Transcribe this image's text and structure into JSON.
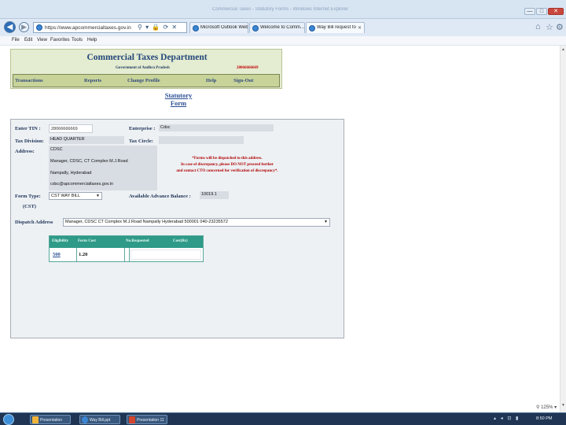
{
  "window": {
    "title": "Commercial Taxes - Statutory Forms - Windows Internet Explorer",
    "minimize": "—",
    "maximize": "□",
    "close": "✕"
  },
  "browser": {
    "address": "https://www.apcommercialtaxes.gov.in/ctd/dealer",
    "address_icons": "⚲ ▾ 🔒 ⟳ ✕",
    "tabs": [
      {
        "label": "Microsoft Outlook Web"
      },
      {
        "label": "Welcome to Comm..."
      },
      {
        "label": "Way Bill request form"
      }
    ],
    "tab_close": "✕",
    "home_icon": "⌂",
    "favorites_icon": "☆",
    "tools_icon": "⚙"
  },
  "menu": {
    "items": [
      "File",
      "Edit",
      "View",
      "Favorites",
      "Tools",
      "Help"
    ]
  },
  "header": {
    "title": "Commercial Taxes Department",
    "subtitle": "Government of Andhra Pradesh",
    "number": "28066666669",
    "nav": [
      "Transactions",
      "Reports",
      "Change Profile",
      "Help",
      "Sign-Out"
    ]
  },
  "page_heading": {
    "line1": "Statutory",
    "line2": "Form"
  },
  "form": {
    "tin_label": "Enter TIN :",
    "tin_value": "28066666669",
    "enterprise_label": "Enterprise :",
    "enterprise_value": "Cdsc",
    "tax_division_label": "Tax Division:",
    "tax_division_value": "HEAD QUARTER",
    "tax_circle_label": "Tax Circle:",
    "tax_circle_value": "",
    "address_label": "Address:",
    "address_lines": [
      "CDSC",
      "Manager, CDSC, CT Complex M.J.Road",
      "Nampally, Hyderabad",
      "cdsc@apcommercialtaxes.gov.in"
    ],
    "notice_lines": [
      "*Forms will be dispatched to this address.",
      "In case of discrepancy, please DO NOT proceed further",
      "and contact CTO concerned for verification of discrepancy*."
    ],
    "form_type_label": "Form Type:",
    "form_type_value": "CST WAY BILL",
    "cst_label": "(CST)",
    "balance_label": "Available Advance Balance :",
    "balance_value": "10019.1",
    "dispatch_label": "Dispatch Address",
    "dispatch_value": "Manager, CDSC CT Complex M.J.Road Nampally Hyderabad 500001 040-23235572",
    "table": {
      "headers": [
        "Eligibility",
        "Form Cost",
        "No.Requested",
        "Cost(Rs)"
      ],
      "rows": [
        {
          "eligibility": "500",
          "form_cost": "1.20",
          "requested": "",
          "cost": ""
        }
      ]
    }
  },
  "statusbar": {
    "zoom": "125%"
  },
  "taskbar": {
    "buttons": [
      {
        "label": "Presentation",
        "color": "#f0b43a"
      },
      {
        "label": "Way Bill.ppt",
        "color": "#3b86d4"
      },
      {
        "label": "Presentation 11",
        "color": "#d2452e"
      }
    ],
    "time": "8:50 PM",
    "tray": "▴ ◂ ⊡ ▮"
  }
}
